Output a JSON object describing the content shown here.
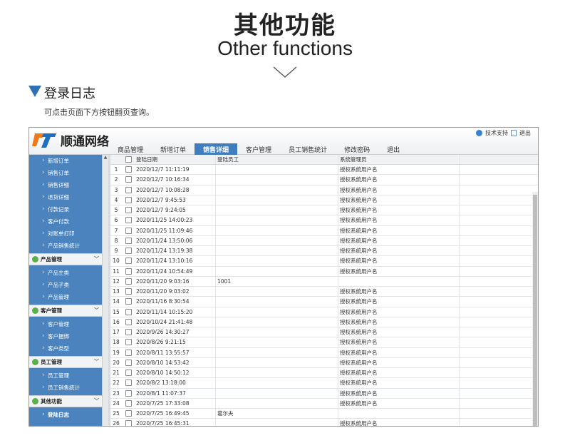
{
  "hero": {
    "title_cn": "其他功能",
    "title_en": "Other functions"
  },
  "section": {
    "title": "登录日志",
    "desc": "可点击页面下方按钮翻页查询。"
  },
  "app": {
    "brand": "顺通网络",
    "top_links": {
      "support": "技术支持",
      "logout": "退出"
    },
    "tabs": [
      "商品管理",
      "新增订单",
      "销售详细",
      "客户管理",
      "员工销售统计",
      "修改密码",
      "退出"
    ],
    "active_tab": 2,
    "sidebar": {
      "items_top": [
        "新增订单",
        "销售订单",
        "销售详细",
        "退货详细",
        "付款记录",
        "客户付款",
        "对账单打印",
        "产品销售统计"
      ],
      "group_products": "产品管理",
      "items_products": [
        "产品主类",
        "产品子类",
        "产品管理"
      ],
      "group_customers": "客户管理",
      "items_customers": [
        "客户管理",
        "客户捆绑",
        "客户类型"
      ],
      "group_staff": "员工管理",
      "items_staff": [
        "员工管理",
        "员工销售统计"
      ],
      "group_other": "其他功能",
      "items_other": [
        "登陆日志"
      ]
    },
    "grid": {
      "headers": {
        "date": "登陆日期",
        "employee": "登陆员工",
        "admin": "系统管理员"
      },
      "rows": [
        {
          "n": "1",
          "date": "2020/12/7 11:11:19",
          "emp": "",
          "adm": "授权系统用户名"
        },
        {
          "n": "2",
          "date": "2020/12/7 10:16:34",
          "emp": "",
          "adm": "授权系统用户名"
        },
        {
          "n": "3",
          "date": "2020/12/7 10:08:28",
          "emp": "",
          "adm": "授权系统用户名"
        },
        {
          "n": "4",
          "date": "2020/12/7 9:45:53",
          "emp": "",
          "adm": "授权系统用户名"
        },
        {
          "n": "5",
          "date": "2020/12/7 9:24:05",
          "emp": "",
          "adm": "授权系统用户名"
        },
        {
          "n": "6",
          "date": "2020/11/25 14:00:23",
          "emp": "",
          "adm": "授权系统用户名"
        },
        {
          "n": "7",
          "date": "2020/11/25 11:09:46",
          "emp": "",
          "adm": "授权系统用户名"
        },
        {
          "n": "8",
          "date": "2020/11/24 13:50:06",
          "emp": "",
          "adm": "授权系统用户名"
        },
        {
          "n": "9",
          "date": "2020/11/24 13:19:38",
          "emp": "",
          "adm": "授权系统用户名"
        },
        {
          "n": "10",
          "date": "2020/11/24 13:10:16",
          "emp": "",
          "adm": "授权系统用户名"
        },
        {
          "n": "11",
          "date": "2020/11/24 10:54:49",
          "emp": "",
          "adm": "授权系统用户名"
        },
        {
          "n": "12",
          "date": "2020/11/20 9:03:16",
          "emp": "1001",
          "adm": ""
        },
        {
          "n": "13",
          "date": "2020/11/20 9:03:02",
          "emp": "",
          "adm": "授权系统用户名"
        },
        {
          "n": "14",
          "date": "2020/11/16 8:30:54",
          "emp": "",
          "adm": "授权系统用户名"
        },
        {
          "n": "15",
          "date": "2020/11/14 10:15:20",
          "emp": "",
          "adm": "授权系统用户名"
        },
        {
          "n": "16",
          "date": "2020/10/24 21:41:48",
          "emp": "",
          "adm": "授权系统用户名"
        },
        {
          "n": "17",
          "date": "2020/9/26 14:30:27",
          "emp": "",
          "adm": "授权系统用户名"
        },
        {
          "n": "18",
          "date": "2020/8/26 9:21:15",
          "emp": "",
          "adm": "授权系统用户名"
        },
        {
          "n": "19",
          "date": "2020/8/11 13:55:57",
          "emp": "",
          "adm": "授权系统用户名"
        },
        {
          "n": "20",
          "date": "2020/8/10 14:53:42",
          "emp": "",
          "adm": "授权系统用户名"
        },
        {
          "n": "21",
          "date": "2020/8/10 14:50:12",
          "emp": "",
          "adm": "授权系统用户名"
        },
        {
          "n": "22",
          "date": "2020/8/2 13:18:00",
          "emp": "",
          "adm": "授权系统用户名"
        },
        {
          "n": "23",
          "date": "2020/8/1 11:07:37",
          "emp": "",
          "adm": "授权系统用户名"
        },
        {
          "n": "24",
          "date": "2020/7/25 17:33:08",
          "emp": "",
          "adm": "授权系统用户名"
        },
        {
          "n": "25",
          "date": "2020/7/25 16:49:45",
          "emp": "葛尔夫",
          "adm": ""
        },
        {
          "n": "26",
          "date": "2020/7/25 16:45:31",
          "emp": "",
          "adm": "授权系统用户名"
        }
      ]
    }
  },
  "colors": {
    "accent": "#3e7dbf",
    "sidebar": "#4a83bd",
    "logo_orange": "#f07a1a",
    "logo_blue": "#1f6fc1"
  }
}
